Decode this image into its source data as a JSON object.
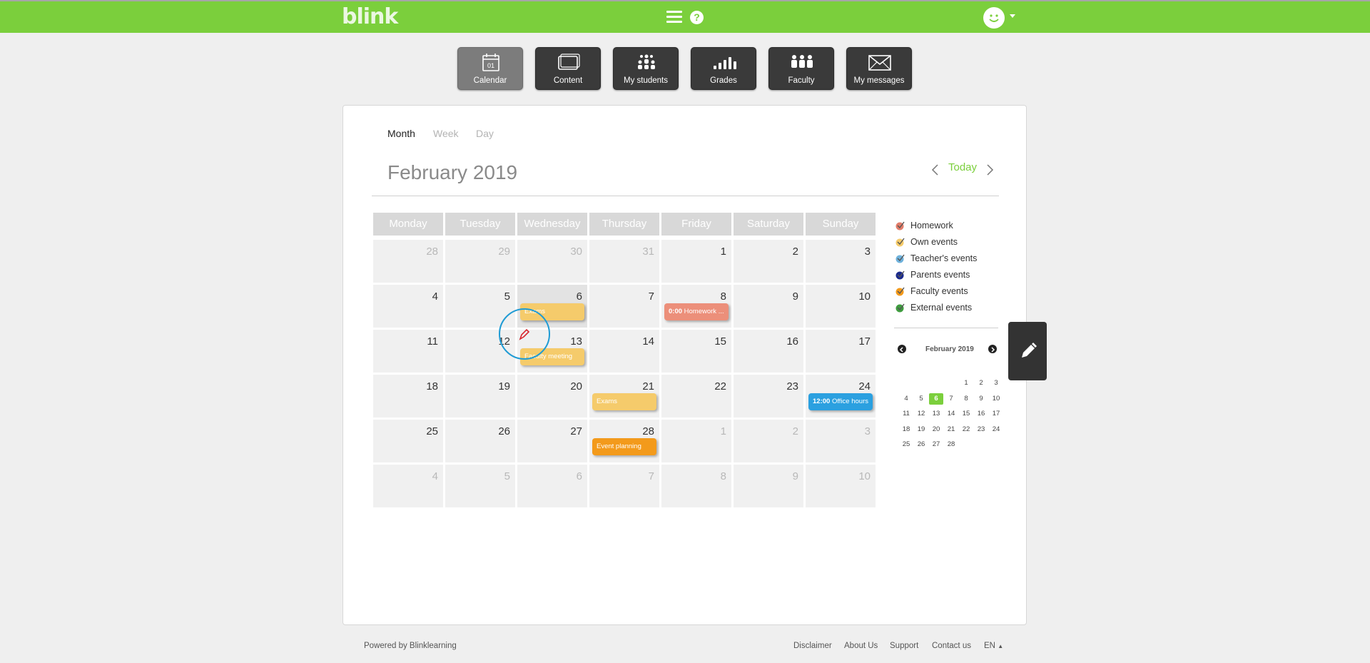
{
  "brand": {
    "logo": "blink",
    "accent": "#7bcf3c"
  },
  "header": {
    "menu_icon": "hamburger-icon",
    "help_icon": "help-icon",
    "help_glyph": "?",
    "avatar_icon": "smiley-avatar-icon"
  },
  "apps": [
    {
      "label": "Calendar",
      "icon": "calendar-icon",
      "active": true
    },
    {
      "label": "Content",
      "icon": "content-icon"
    },
    {
      "label": "My students",
      "icon": "students-icon"
    },
    {
      "label": "Grades",
      "icon": "grades-icon"
    },
    {
      "label": "Faculty",
      "icon": "faculty-icon"
    },
    {
      "label": "My messages",
      "icon": "envelope-icon"
    }
  ],
  "calendar_icon_text": "01",
  "view_tabs": [
    "Month",
    "Week",
    "Day"
  ],
  "active_view": "Month",
  "month_title": "February 2019",
  "today_label": "Today",
  "weekdays": [
    "Monday",
    "Tuesday",
    "Wednesday",
    "Thursday",
    "Friday",
    "Saturday",
    "Sunday"
  ],
  "weeks": [
    [
      {
        "d": "28",
        "dim": true
      },
      {
        "d": "29",
        "dim": true
      },
      {
        "d": "30",
        "dim": true
      },
      {
        "d": "31",
        "dim": true
      },
      {
        "d": "1"
      },
      {
        "d": "2"
      },
      {
        "d": "3"
      }
    ],
    [
      {
        "d": "4"
      },
      {
        "d": "5"
      },
      {
        "d": "6",
        "selected": true
      },
      {
        "d": "7"
      },
      {
        "d": "8"
      },
      {
        "d": "9"
      },
      {
        "d": "10"
      }
    ],
    [
      {
        "d": "11"
      },
      {
        "d": "12"
      },
      {
        "d": "13"
      },
      {
        "d": "14"
      },
      {
        "d": "15"
      },
      {
        "d": "16"
      },
      {
        "d": "17"
      }
    ],
    [
      {
        "d": "18"
      },
      {
        "d": "19"
      },
      {
        "d": "20"
      },
      {
        "d": "21"
      },
      {
        "d": "22"
      },
      {
        "d": "23"
      },
      {
        "d": "24"
      }
    ],
    [
      {
        "d": "25"
      },
      {
        "d": "26"
      },
      {
        "d": "27"
      },
      {
        "d": "28"
      },
      {
        "d": "1",
        "dim": true
      },
      {
        "d": "2",
        "dim": true
      },
      {
        "d": "3",
        "dim": true
      }
    ],
    [
      {
        "d": "4",
        "dim": true
      },
      {
        "d": "5",
        "dim": true
      },
      {
        "d": "6",
        "dim": true
      },
      {
        "d": "7",
        "dim": true
      },
      {
        "d": "8",
        "dim": true
      },
      {
        "d": "9",
        "dim": true
      },
      {
        "d": "10",
        "dim": true
      }
    ]
  ],
  "events": [
    {
      "week": 1,
      "day": 2,
      "time": "",
      "text": "Exams",
      "color": "#f5cb6b"
    },
    {
      "week": 1,
      "day": 4,
      "time": "0:00",
      "text": "Homework ...",
      "color": "#ec8f7a"
    },
    {
      "week": 2,
      "day": 2,
      "time": "",
      "text": "Faculty meeting",
      "color": "#f5cb6b"
    },
    {
      "week": 3,
      "day": 3,
      "time": "",
      "text": "Exams",
      "color": "#f5cb6b"
    },
    {
      "week": 3,
      "day": 6,
      "time": "12:00",
      "text": "Office hours",
      "color": "#2ba0e0"
    },
    {
      "week": 4,
      "day": 3,
      "time": "",
      "text": "Event planning",
      "color": "#f39a1b"
    }
  ],
  "legend": [
    {
      "label": "Homework",
      "color": "#e27d6a"
    },
    {
      "label": "Own events",
      "color": "#f5cb6b"
    },
    {
      "label": "Teacher's events",
      "color": "#6fb2dc"
    },
    {
      "label": "Parents events",
      "color": "#1a2a8c"
    },
    {
      "label": "Faculty events",
      "color": "#f39a1b"
    },
    {
      "label": "External events",
      "color": "#3f9d3f"
    }
  ],
  "mini_calendar": {
    "title": "February 2019",
    "today": "6",
    "weeks": [
      [
        "",
        "",
        "",
        "",
        "1",
        "2",
        "3"
      ],
      [
        "4",
        "5",
        "6",
        "7",
        "8",
        "9",
        "10"
      ],
      [
        "11",
        "12",
        "13",
        "14",
        "15",
        "16",
        "17"
      ],
      [
        "18",
        "19",
        "20",
        "21",
        "22",
        "23",
        "24"
      ],
      [
        "25",
        "26",
        "27",
        "28",
        "",
        "",
        ""
      ]
    ]
  },
  "fab_icon": "pencil-icon",
  "footer": {
    "powered": "Powered by Blinklearning",
    "links": [
      "Disclaimer",
      "About Us",
      "Support",
      "Contact us"
    ],
    "lang": "EN"
  }
}
